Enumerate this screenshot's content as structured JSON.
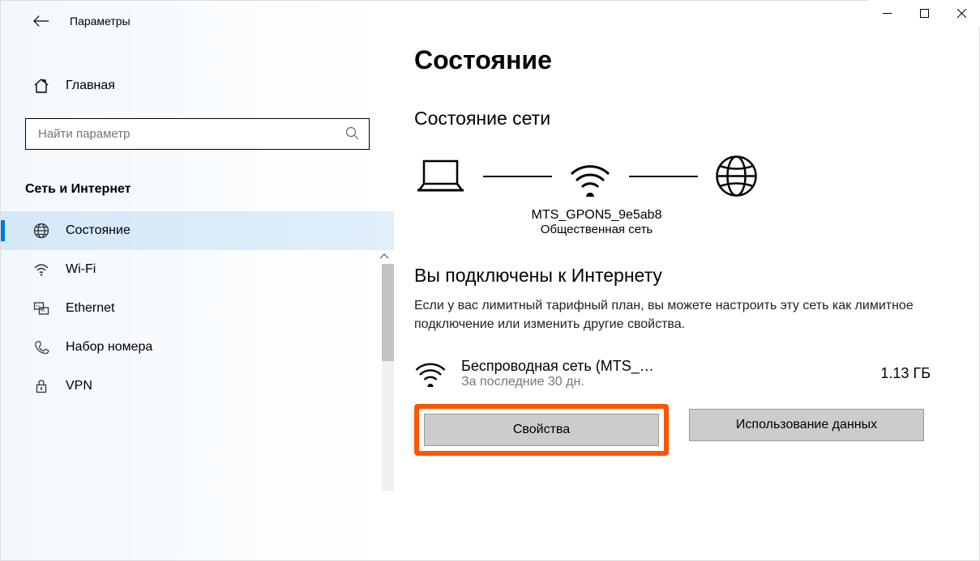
{
  "windowTitle": "Параметры",
  "sidebar": {
    "home": "Главная",
    "searchPlaceholder": "Найти параметр",
    "sectionHeader": "Сеть и Интернет",
    "items": [
      {
        "label": "Состояние",
        "icon": "globe-icon",
        "selected": true
      },
      {
        "label": "Wi-Fi",
        "icon": "wifi-icon",
        "selected": false
      },
      {
        "label": "Ethernet",
        "icon": "ethernet-icon",
        "selected": false
      },
      {
        "label": "Набор номера",
        "icon": "dialup-icon",
        "selected": false
      },
      {
        "label": "VPN",
        "icon": "vpn-icon",
        "selected": false
      }
    ]
  },
  "content": {
    "pageTitle": "Состояние",
    "networkStatusTitle": "Состояние сети",
    "diagram": {
      "ssid": "MTS_GPON5_9e5ab8",
      "networkType": "Общественная сеть"
    },
    "connectedHeading": "Вы подключены к Интернету",
    "connectedDesc": "Если у вас лимитный тарифный план, вы можете настроить эту сеть как лимитное подключение или изменить другие свойства.",
    "networkEntry": {
      "title": "Беспроводная сеть (MTS_…",
      "sub": "За последние 30 дн.",
      "usage": "1.13 ГБ"
    },
    "buttons": {
      "properties": "Свойства",
      "dataUsage": "Использование данных"
    }
  }
}
